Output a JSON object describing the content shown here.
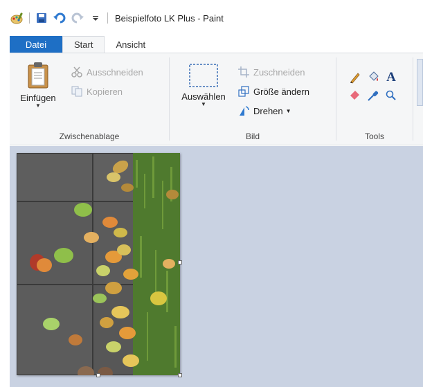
{
  "window": {
    "title": "Beispielfoto LK Plus - Paint"
  },
  "quick_access": {
    "icons": [
      "paint-logo-icon",
      "save-icon",
      "undo-icon",
      "redo-icon",
      "customize-dropdown-icon"
    ]
  },
  "tabs": [
    {
      "label": "Datei",
      "active": false
    },
    {
      "label": "Start",
      "active": true
    },
    {
      "label": "Ansicht",
      "active": false
    }
  ],
  "groups": {
    "clipboard": {
      "label": "Zwischenablage",
      "paste": "Einfügen",
      "cut": "Ausschneiden",
      "copy": "Kopieren"
    },
    "image": {
      "label": "Bild",
      "select": "Auswählen",
      "crop": "Zuschneiden",
      "resize": "Größe ändern",
      "rotate": "Drehen"
    },
    "tools": {
      "label": "Tools",
      "items": [
        "pencil-icon",
        "fill-icon",
        "text-icon",
        "eraser-icon",
        "color-picker-icon",
        "magnifier-icon"
      ]
    }
  },
  "colors": {
    "file_tab": "#1e6fc5",
    "ribbon_bg": "#f5f6f7",
    "workspace_bg": "#c9d2e2"
  }
}
